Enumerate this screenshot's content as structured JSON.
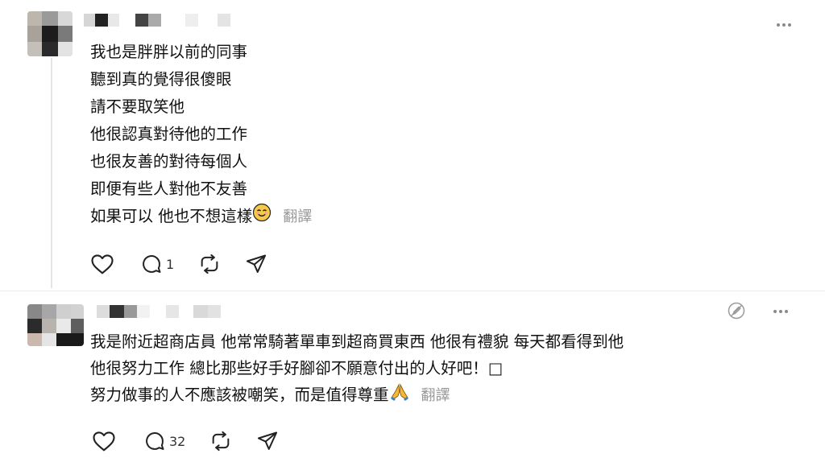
{
  "comments": [
    {
      "lines": [
        "我也是胖胖以前的同事",
        "聽到真的覺得很傻眼",
        "請不要取笑他",
        "他很認真對待他的工作",
        "也很友善的對待每個人",
        "即便有些人對他不友善",
        "如果可以 他也不想這樣"
      ],
      "translate_label": "翻譯",
      "reply_count": "1",
      "icons": [
        "heart-icon",
        "reply-icon",
        "repost-icon",
        "share-icon",
        "more-icon",
        "smiling-face-emoji"
      ]
    },
    {
      "lines": [
        "我是附近超商店員 他常常騎著單車到超商買東西 他很有禮貌 每天都看得到他",
        "他很努力工作 總比那些好手好腳卻不願意付出的人好吧！□",
        "努力做事的人不應該被嘲笑，而是值得尊重"
      ],
      "translate_label": "翻譯",
      "reply_count": "32",
      "icons": [
        "heart-icon",
        "reply-icon",
        "repost-icon",
        "share-icon",
        "more-icon",
        "edit-disabled-icon",
        "praying-hands-emoji"
      ]
    }
  ],
  "colors": {
    "text": "#111111",
    "muted": "#999999",
    "icon": "#222222",
    "divider": "#ececec"
  }
}
